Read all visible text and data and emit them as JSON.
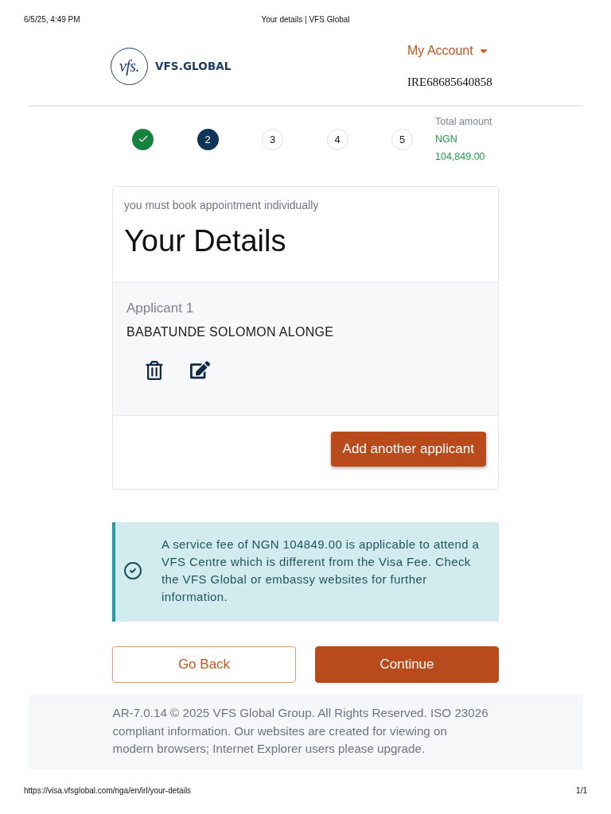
{
  "print_header": {
    "date": "6/5/25, 4:49 PM",
    "title": "Your details | VFS Global"
  },
  "header": {
    "logo_mark": "vfs.",
    "logo_name": "VFS.GLOBAL",
    "account_menu": "My Account",
    "reference": "IRE68685640858"
  },
  "stepper": {
    "steps": [
      {
        "kind": "done"
      },
      {
        "kind": "current",
        "number": "2"
      },
      {
        "kind": "pending",
        "number": "3"
      },
      {
        "kind": "pending",
        "number": "4"
      },
      {
        "kind": "pending",
        "number": "5"
      }
    ],
    "total": {
      "label": "Total amount",
      "currency": "NGN",
      "amount": "104,849.00"
    }
  },
  "card": {
    "note": "you must book appointment individually",
    "title": "Your Details",
    "applicants": [
      {
        "label": "Applicant 1",
        "name": "BABATUNDE SOLOMON ALONGE"
      }
    ],
    "add_button": "Add another applicant"
  },
  "alert": {
    "text": "A service fee of NGN 104849.00 is applicable to attend a VFS Centre which is different from the Visa Fee. Check the VFS Global or embassy websites for further information."
  },
  "actions": [
    {
      "label": "Go Back",
      "kind": "secondary"
    },
    {
      "label": "Continue",
      "kind": "primary"
    }
  ],
  "footer": {
    "text": "AR-7.0.14 © 2025 VFS Global Group. All Rights Reserved. ISO 23026 compliant information. Our websites are created for viewing on modern browsers; Internet Explorer users please upgrade."
  },
  "print_footer": {
    "url": "https://visa.vfsglobal.com/nga/en/irl/your-details",
    "page": "1/1"
  }
}
